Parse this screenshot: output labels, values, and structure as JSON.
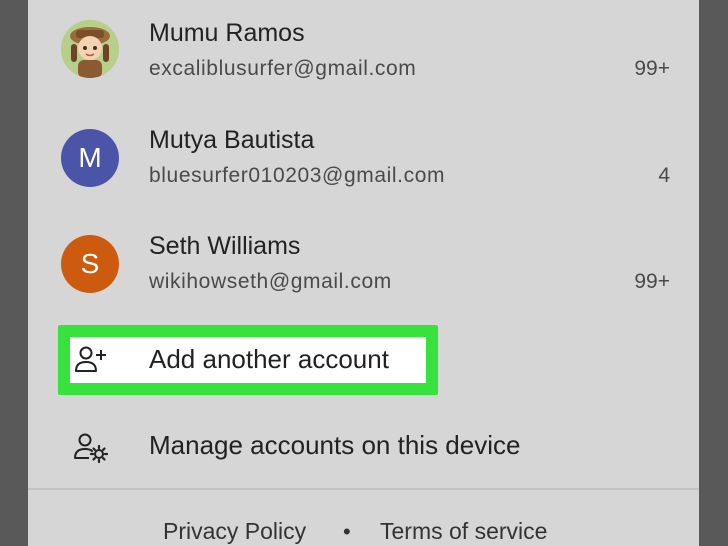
{
  "accounts": [
    {
      "name": "Mumu Ramos",
      "email": "excaliblusurfer@gmail.com",
      "count": "99+",
      "avatar_type": "photo"
    },
    {
      "name": "Mutya Bautista",
      "email": "bluesurfer010203@gmail.com",
      "count": "4",
      "avatar_letter": "M",
      "avatar_color": "#4a55a8"
    },
    {
      "name": "Seth Williams",
      "email": "wikihowseth@gmail.com",
      "count": "99+",
      "avatar_letter": "S",
      "avatar_color": "#cc5a0f"
    }
  ],
  "actions": {
    "add_account": {
      "label": "Add another account",
      "icon": "person-add-icon"
    },
    "manage_accounts": {
      "label": "Manage accounts on this device",
      "icon": "manage-accounts-icon"
    }
  },
  "footer": {
    "privacy": "Privacy Policy",
    "separator": "•",
    "terms": "Terms of service"
  },
  "colors": {
    "highlight": "#36e23b",
    "sheet_background": "#d6d6d6",
    "outer_background": "#595959"
  }
}
